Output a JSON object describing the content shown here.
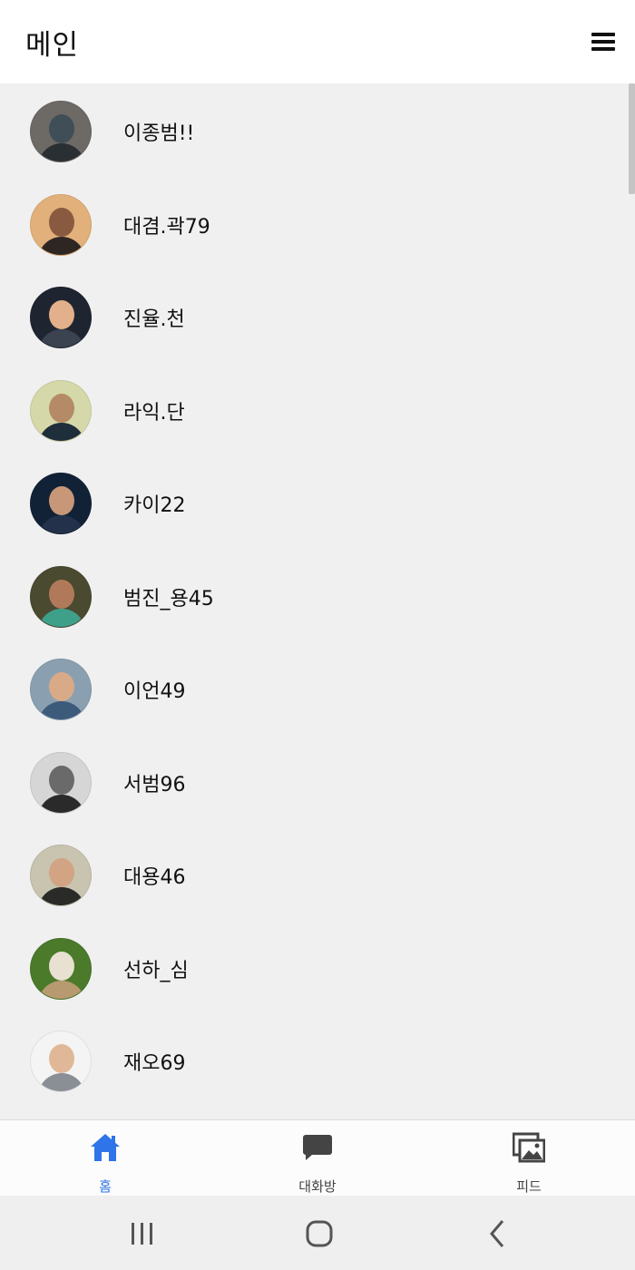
{
  "header": {
    "title": "메인"
  },
  "friends": [
    {
      "name": "이종범!!",
      "avatar": "avatar-laptop",
      "bg": "#6d6a66",
      "skin": "#3f4e57",
      "shirt": "#2a2f33"
    },
    {
      "name": "대겸.곽79",
      "avatar": "avatar-woman-sunset",
      "bg": "#e2b07a",
      "skin": "#8a5a40",
      "shirt": "#2e2622"
    },
    {
      "name": "진율.천",
      "avatar": "avatar-blond-man",
      "bg": "#1f2530",
      "skin": "#e2b08a",
      "shirt": "#3b4250"
    },
    {
      "name": "라익.단",
      "avatar": "avatar-man-cap",
      "bg": "#d5d8a8",
      "skin": "#b58a66",
      "shirt": "#1e2e3a"
    },
    {
      "name": "카이22",
      "avatar": "avatar-smiling-man",
      "bg": "#122236",
      "skin": "#c79778",
      "shirt": "#23324a"
    },
    {
      "name": "범진_용45",
      "avatar": "avatar-woman-glasses",
      "bg": "#4a4a30",
      "skin": "#b07a5a",
      "shirt": "#3fa08a"
    },
    {
      "name": "이언49",
      "avatar": "avatar-man-glasses",
      "bg": "#8aa0b0",
      "skin": "#d8aa88",
      "shirt": "#3c5a7a"
    },
    {
      "name": "서범96",
      "avatar": "avatar-bw-bearded",
      "bg": "#d6d6d6",
      "skin": "#6a6a6a",
      "shirt": "#2a2a2a"
    },
    {
      "name": "대용46",
      "avatar": "avatar-beanie",
      "bg": "#c8c4b0",
      "skin": "#d2a484",
      "shirt": "#2a2a28"
    },
    {
      "name": "선하_심",
      "avatar": "avatar-cat",
      "bg": "#4a7a2a",
      "skin": "#e8e0d0",
      "shirt": "#b89a70"
    },
    {
      "name": "재오69",
      "avatar": "avatar-man-white-bg",
      "bg": "#f4f4f4",
      "skin": "#e0b898",
      "shirt": "#8a8f96"
    }
  ],
  "tabs": [
    {
      "label": "홈",
      "icon": "home-icon",
      "active": true
    },
    {
      "label": "대화방",
      "icon": "chat-icon",
      "active": false
    },
    {
      "label": "피드",
      "icon": "gallery-icon",
      "active": false
    }
  ],
  "colors": {
    "accent": "#2f74e8",
    "inactive_icon": "#444444"
  },
  "system_nav": [
    {
      "icon": "recent-apps-icon"
    },
    {
      "icon": "home-circle-icon"
    },
    {
      "icon": "back-icon"
    }
  ]
}
